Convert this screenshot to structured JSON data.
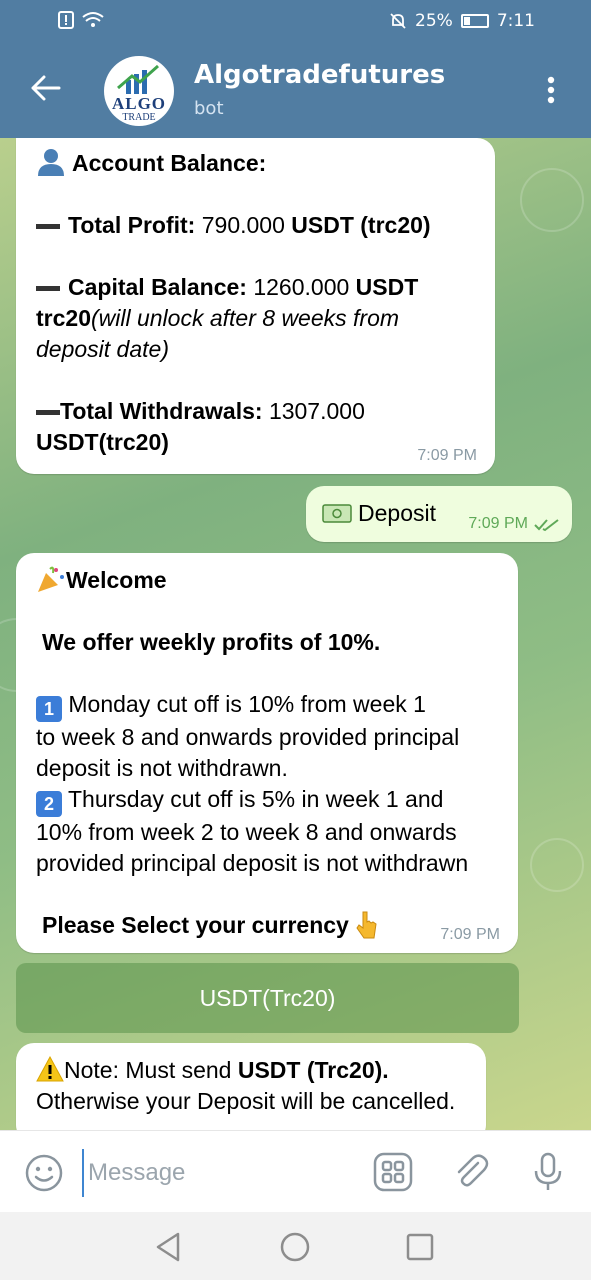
{
  "status_bar": {
    "battery": "25%",
    "time": "7:11"
  },
  "header": {
    "title": "Algotradefutures",
    "subtitle": "bot",
    "avatar_text": "ALGO",
    "avatar_sub": "TRADE"
  },
  "messages": {
    "balance": {
      "title": "Account Balance:",
      "profit_label": "Total Profit:",
      "profit_value": "790.000",
      "profit_unit": "USDT (trc20)",
      "capital_label": "Capital Balance:",
      "capital_value": "1260.000",
      "capital_unit": "USDT",
      "capital_unit2": "trc20",
      "capital_note_1": "(will unlock after 8 weeks from",
      "capital_note_2": "deposit date)",
      "withdrawals_label": "Total Withdrawals:",
      "withdrawals_value": "1307.000",
      "withdrawals_unit": "USDT(trc20)",
      "time": "7:09 PM"
    },
    "deposit": {
      "text": "Deposit",
      "time": "7:09 PM"
    },
    "welcome": {
      "title": "Welcome",
      "offer": "We offer weekly profits of 10%.",
      "badge1": "1",
      "line1a": "Monday cut off is 10% from week 1",
      "line1b": "to week 8 and onwards provided principal",
      "line1c": "deposit is not withdrawn.",
      "badge2": "2",
      "line2a": "Thursday cut off is 5% in week 1 and",
      "line2b": "10% from week 2 to week 8 and onwards",
      "line2c": "provided principal deposit is not withdrawn",
      "select": "Please Select your currency",
      "time": "7:09 PM"
    },
    "note": {
      "prefix": "Note: Must send",
      "currency": "USDT (Trc20).",
      "line2": "Otherwise your Deposit will be cancelled."
    }
  },
  "keyboard": {
    "button": "USDT(Trc20)"
  },
  "input": {
    "placeholder": "Message"
  }
}
